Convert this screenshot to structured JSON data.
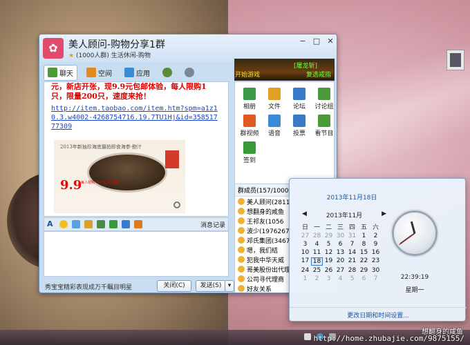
{
  "qq": {
    "title": "美人顾问-购物分享1群",
    "sub": "(1000人群) 生活休闲-购物",
    "banner": {
      "top": "[屠龙斩]",
      "left": "开始游戏",
      "right": "复选戒指"
    },
    "tabs": [
      "聊天",
      "空间",
      "应用"
    ],
    "chat": {
      "text": "元，新店开张，现9.9元包邮体验，每人限购1只，限量200只，速度来抢！",
      "link": "http://item.taobao.com/item.htm?spm=a1z10.3.w4002-4268754716.19.7TU1Hj&id=35851777309",
      "promo_header": "2013年新抽珍海底摄拍即食海参·鲍汁",
      "promo_price": "9.9",
      "promo_tag": "每人限购一只 元/头/包邮"
    },
    "apps": [
      "相册",
      "文件",
      "论坛",
      "讨论组",
      "群视频",
      "语音",
      "投票",
      "看节目",
      "签到"
    ],
    "members_title": "群成员(157/1000)",
    "members": [
      "美人顾问(2811",
      "想翻身的咸鱼",
      "王祁友(1056",
      "波少(19762678",
      "邓氏集团(3467",
      "嗯，我们结",
      "犯我中华天威",
      "哥美股份出代理",
      "公司寻代理商",
      "好友关系"
    ],
    "msg_record": "消息记录",
    "footer_ad": "秀宝宝精彩表现成万千瞩目明星",
    "close_btn": "关闭(C)",
    "send_btn": "发送(S)"
  },
  "clock": {
    "date": "2013年11月18日",
    "month": "2013年11月",
    "weekdays": [
      "日",
      "一",
      "二",
      "三",
      "四",
      "五",
      "六"
    ],
    "days": [
      [
        "27",
        "28",
        "29",
        "30",
        "31",
        "1",
        "2"
      ],
      [
        "3",
        "4",
        "5",
        "6",
        "7",
        "8",
        "9"
      ],
      [
        "10",
        "11",
        "12",
        "13",
        "14",
        "15",
        "16"
      ],
      [
        "17",
        "18",
        "19",
        "20",
        "21",
        "22",
        "23"
      ],
      [
        "24",
        "25",
        "26",
        "27",
        "28",
        "29",
        "30"
      ],
      [
        "1",
        "2",
        "3",
        "4",
        "5",
        "6",
        "7"
      ]
    ],
    "today": "18",
    "time": "22:39:19",
    "weekday": "星期一",
    "link": "更改日期和时间设置..."
  },
  "watermark": {
    "line1": "想翻身的咸鱼",
    "line2": "http://home.zhubajie.com/9875155/"
  }
}
